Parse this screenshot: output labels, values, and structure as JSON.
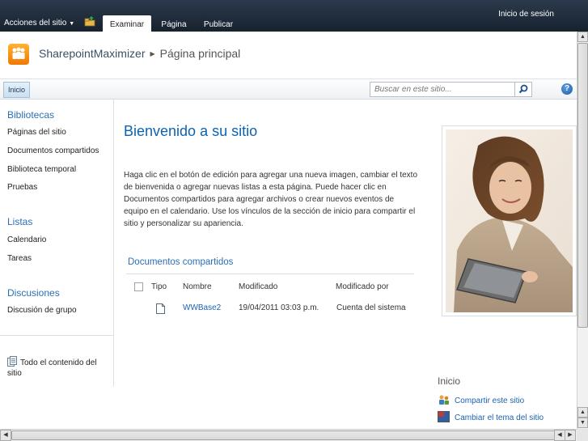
{
  "ribbon": {
    "site_actions": "Acciones del sitio",
    "tabs": [
      "Examinar",
      "Página",
      "Publicar"
    ],
    "signin": "Inicio de sesión"
  },
  "title": {
    "site": "SharepointMaximizer",
    "page": "Página principal"
  },
  "topnav": {
    "home": "Inicio",
    "search_placeholder": "Buscar en este sitio..."
  },
  "leftnav": {
    "sections": [
      {
        "heading": "Bibliotecas",
        "items": [
          "Páginas del sitio",
          "Documentos compartidos",
          "Biblioteca temporal",
          "Pruebas"
        ]
      },
      {
        "heading": "Listas",
        "items": [
          "Calendario",
          "Tareas"
        ]
      },
      {
        "heading": "Discusiones",
        "items": [
          "Discusión de grupo"
        ]
      }
    ],
    "all_content": "Todo el contenido del sitio"
  },
  "main": {
    "title": "Bienvenido a su sitio",
    "text": "Haga clic en el botón de edición para agregar una nueva imagen, cambiar el texto de bienvenida o agregar nuevas listas a esta página. Puede hacer clic en Documentos compartidos para agregar archivos o crear nuevos eventos de equipo en el calendario. Use los vínculos de la sección de inicio para compartir el sitio y personalizar su apariencia."
  },
  "documents": {
    "title": "Documentos compartidos",
    "columns": [
      "Tipo",
      "Nombre",
      "Modificado",
      "Modificado por"
    ],
    "rows": [
      {
        "name": "WWBase2",
        "modified": "19/04/2011 03:03 p.m.",
        "modified_by": "Cuenta del sistema"
      }
    ]
  },
  "getting_started": {
    "title": "Inicio",
    "items": [
      "Compartir este sitio",
      "Cambiar el tema del sitio"
    ]
  },
  "colors": {
    "ribbon_bg": "#1f2b3a",
    "link": "#1d63b3",
    "title_blue": "#0b63b0",
    "logo_orange": "#f79a1e"
  }
}
